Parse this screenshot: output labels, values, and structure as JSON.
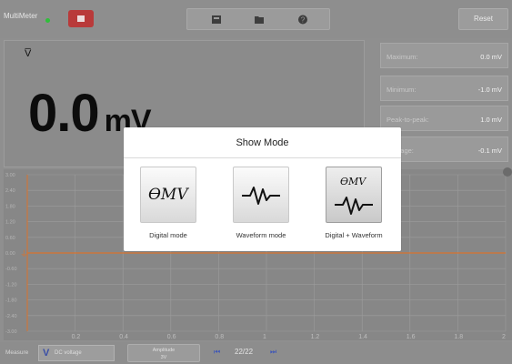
{
  "app": {
    "title": "MultiMeter"
  },
  "toolbar": {
    "reset_label": "Reset",
    "icons": [
      "record-icon",
      "folder-icon",
      "help-icon"
    ]
  },
  "reading": {
    "symbol": "V̅",
    "value": "0.0",
    "unit": "mV"
  },
  "stats": [
    {
      "label": "Maximum:",
      "value": "0.0 mV"
    },
    {
      "label": "Minimum:",
      "value": "-1.0 mV"
    },
    {
      "label": "Peak-to-peak:",
      "value": "1.0 mV"
    },
    {
      "label": "Average:",
      "value": "-0.1 mV"
    }
  ],
  "chart": {
    "y_ticks": [
      "3.00",
      "2.40",
      "1.80",
      "1.20",
      "0.60",
      "0.00",
      "-0.60",
      "-1.20",
      "-1.80",
      "-2.40",
      "-3.00"
    ],
    "x_ticks": [
      "0.2",
      "0.4",
      "0.6",
      "0.8",
      "1",
      "1.2",
      "1.4",
      "1.6",
      "1.8",
      "2"
    ],
    "colors": {
      "trace": "#d9732e",
      "grid": "#9c9c9c",
      "background": "#878787"
    }
  },
  "bottom": {
    "measure_label": "Measure",
    "measure_symbol": "V",
    "measure_value": "DC voltage",
    "amplitude_label": "Amplitude",
    "amplitude_value": "3V",
    "page": "22/22"
  },
  "dialog": {
    "title": "Show Mode",
    "omv_text": "ƟMV",
    "modes": [
      {
        "label": "Digital mode",
        "selected": false
      },
      {
        "label": "Waveform mode",
        "selected": false
      },
      {
        "label": "Digital + Waveform",
        "selected": true
      }
    ]
  }
}
